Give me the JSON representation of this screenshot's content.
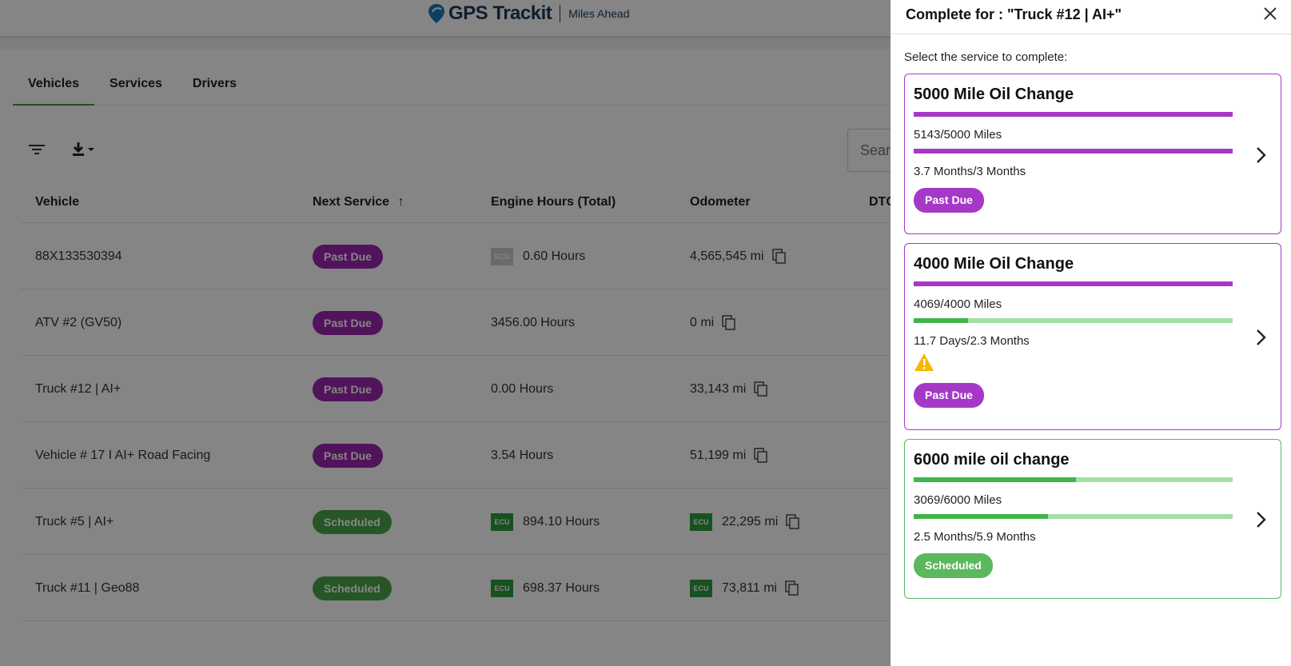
{
  "header": {
    "brand": "GPS Trackit",
    "tagline": "Miles Ahead"
  },
  "tabs": [
    "Vehicles",
    "Services",
    "Drivers"
  ],
  "search": {
    "placeholder": "Search"
  },
  "table": {
    "columns": [
      "Vehicle",
      "Next Service",
      "Engine Hours (Total)",
      "Odometer",
      "DTC"
    ],
    "rows": [
      {
        "vehicle": "88X133530394",
        "status": "Past Due",
        "ecu_hours": true,
        "hours": "0.60 Hours",
        "ecu_odo": false,
        "odometer": "4,565,545 mi"
      },
      {
        "vehicle": "ATV #2  (GV50)",
        "status": "Past Due",
        "ecu_hours": false,
        "hours": "3456.00 Hours",
        "ecu_odo": false,
        "odometer": "0 mi"
      },
      {
        "vehicle": "Truck #12 | AI+",
        "status": "Past Due",
        "ecu_hours": false,
        "hours": "0.00 Hours",
        "ecu_odo": false,
        "odometer": "33,143 mi"
      },
      {
        "vehicle": "Vehicle # 17 I AI+ Road Facing",
        "status": "Past Due",
        "ecu_hours": false,
        "hours": "3.54 Hours",
        "ecu_odo": false,
        "odometer": "51,199 mi"
      },
      {
        "vehicle": "Truck #5 | AI+",
        "status": "Scheduled",
        "ecu_hours": true,
        "hours": "894.10 Hours",
        "ecu_odo": true,
        "odometer": "22,295 mi"
      },
      {
        "vehicle": "Truck #11 | Geo88",
        "status": "Scheduled",
        "ecu_hours": true,
        "hours": "698.37 Hours",
        "ecu_odo": true,
        "odometer": "73,811 mi"
      }
    ],
    "ecu_label": "ECU"
  },
  "drawer": {
    "title": "Complete for : \"Truck #12 | AI+\"",
    "instruction": "Select the service to complete:",
    "cards": [
      {
        "title": "5000 Mile Oil Change",
        "status": "Past Due",
        "color": "#a638c8",
        "title_bar_progress": 1.0,
        "miles_text": "5143/5000 Miles",
        "miles_progress": 1.0,
        "time_text": "3.7 Months/3 Months",
        "warning": false
      },
      {
        "title": "4000 Mile Oil Change",
        "status": "Past Due",
        "color": "#a638c8",
        "title_bar_progress": 1.0,
        "miles_text": "4069/4000 Miles",
        "miles_progress": 0.17,
        "time_text": "11.7 Days/2.3 Months",
        "warning": true
      },
      {
        "title": "6000 mile oil change",
        "status": "Scheduled",
        "color": "#5cb85c",
        "title_bar_progress": 0.51,
        "miles_text": "3069/6000 Miles",
        "miles_progress": 0.42,
        "time_text": "2.5 Months/5.9 Months",
        "warning": false
      }
    ]
  }
}
